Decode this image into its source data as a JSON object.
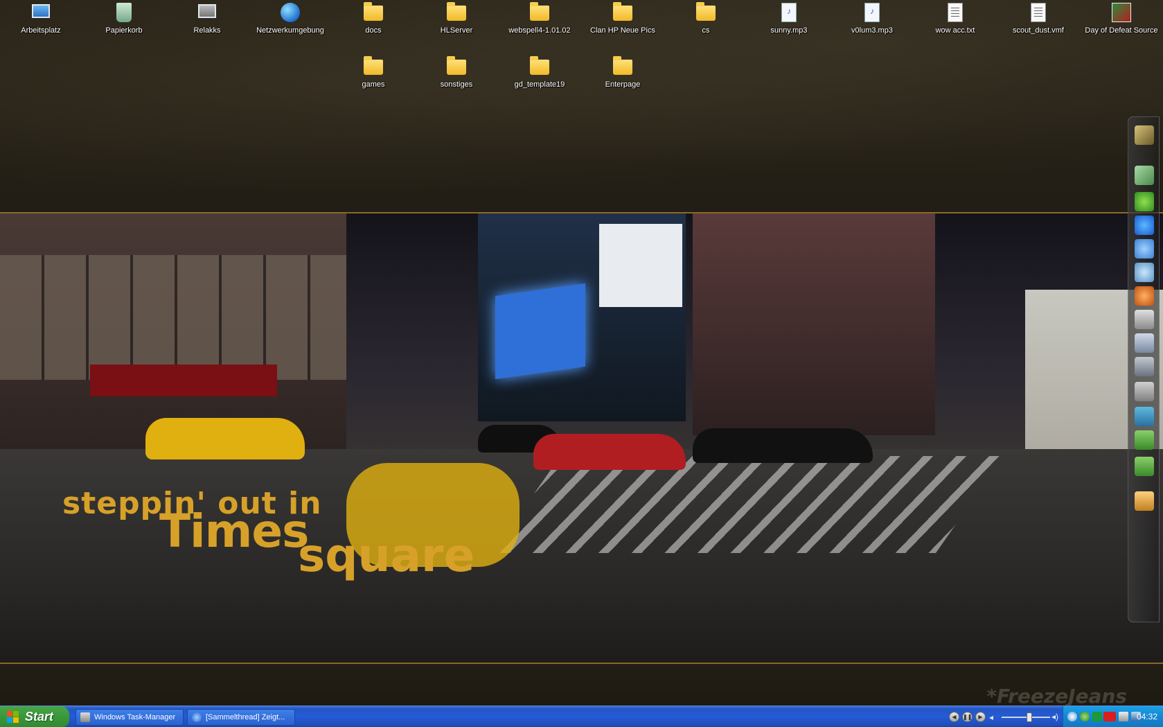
{
  "desktop": {
    "icons_row1": [
      {
        "label": "Arbeitsplatz",
        "icon": "computer-icon"
      },
      {
        "label": "Papierkorb",
        "icon": "recycle-bin-icon"
      },
      {
        "label": "Relakks",
        "icon": "network-shortcut-icon"
      },
      {
        "label": "Netzwerkumgebung",
        "icon": "network-places-icon"
      },
      {
        "label": "docs",
        "icon": "folder-icon"
      },
      {
        "label": "HLServer",
        "icon": "folder-icon"
      },
      {
        "label": "webspell4-1.01.02",
        "icon": "folder-icon"
      },
      {
        "label": "Clan HP Neue Pics",
        "icon": "folder-icon"
      },
      {
        "label": "cs",
        "icon": "folder-icon"
      },
      {
        "label": "sunny.mp3",
        "icon": "mp3-file-icon"
      },
      {
        "label": "v0lum3.mp3",
        "icon": "mp3-file-icon"
      },
      {
        "label": "wow acc.txt",
        "icon": "text-file-icon"
      },
      {
        "label": "scout_dust.vmf",
        "icon": "vmf-file-icon"
      },
      {
        "label": "Day of Defeat Source",
        "icon": "game-shortcut-icon"
      }
    ],
    "icons_row2": [
      {
        "label": "games",
        "icon": "folder-icon"
      },
      {
        "label": "sonstiges",
        "icon": "folder-icon"
      },
      {
        "label": "gd_template19",
        "icon": "folder-icon"
      },
      {
        "label": "Enterpage",
        "icon": "folder-icon"
      }
    ],
    "wallpaper": {
      "line1": "steppin' out in",
      "line2": "Times",
      "line3": "square",
      "watermark": "*FreezeJeans"
    }
  },
  "taskbar": {
    "start_label": "Start",
    "tasks": [
      {
        "label": "Windows Task-Manager",
        "icon": "task-manager-icon"
      },
      {
        "label": "[Sammelthread] Zeigt...",
        "icon": "browser-icon"
      }
    ],
    "clock": "04:32"
  },
  "colors": {
    "taskbar_blue": "#245bd7",
    "start_green": "#3c9a3c",
    "tray_blue": "#1586d0",
    "wallpaper_gold": "#d7a129"
  }
}
